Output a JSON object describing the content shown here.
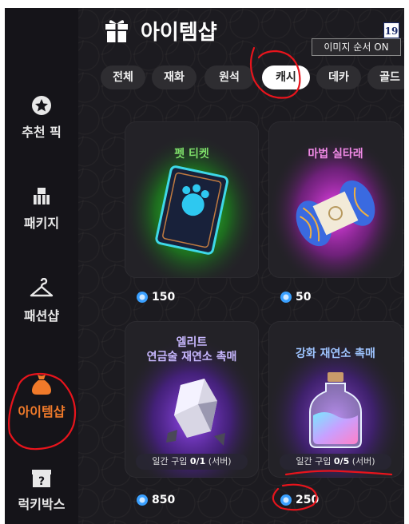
{
  "header": {
    "title": "아이템샵",
    "age_rating": "19",
    "image_order_toggle": "이미지 순서 ON"
  },
  "sidebar": {
    "items": [
      {
        "label": "추천 픽",
        "icon": "star-badge-icon",
        "active": false
      },
      {
        "label": "패키지",
        "icon": "package-boxes-icon",
        "active": false
      },
      {
        "label": "패션샵",
        "icon": "hanger-icon",
        "active": false
      },
      {
        "label": "아이템샵",
        "icon": "money-bag-icon",
        "active": true
      },
      {
        "label": "럭키박스",
        "icon": "mystery-box-icon",
        "active": false
      }
    ]
  },
  "tabs": [
    {
      "label": "전체",
      "active": false
    },
    {
      "label": "재화",
      "active": false
    },
    {
      "label": "원석",
      "active": false
    },
    {
      "label": "캐시",
      "active": true
    },
    {
      "label": "데카",
      "active": false
    },
    {
      "label": "골드",
      "active": false
    }
  ],
  "products": [
    {
      "name": "펫 티켓",
      "name_color": "#7ee06a",
      "price": "150",
      "icon": "pet-ticket-card-icon"
    },
    {
      "name": "마법 실타래",
      "name_color": "#f08ae6",
      "price": "50",
      "icon": "magic-yarn-icon"
    },
    {
      "name_line1": "엘리트",
      "name_line2": "연금술 재연소 촉매",
      "name_color": "#c8b8ff",
      "price": "850",
      "limit_prefix": "일간 구입 ",
      "limit_count": "0/1",
      "limit_suffix": " (서버)",
      "icon": "crystal-ore-icon"
    },
    {
      "name": "강화 재연소 촉매",
      "name_color": "#9ec4ff",
      "price": "250",
      "limit_prefix": "일간 구입 ",
      "limit_count": "0/5",
      "limit_suffix": " (서버)",
      "icon": "potion-bottle-icon"
    }
  ],
  "colors": {
    "background": "#1c1b20",
    "sidebar": "#151419",
    "active_nav": "#f07a2a",
    "annotation": "#e8141c",
    "coin": "#3aa0ff"
  }
}
